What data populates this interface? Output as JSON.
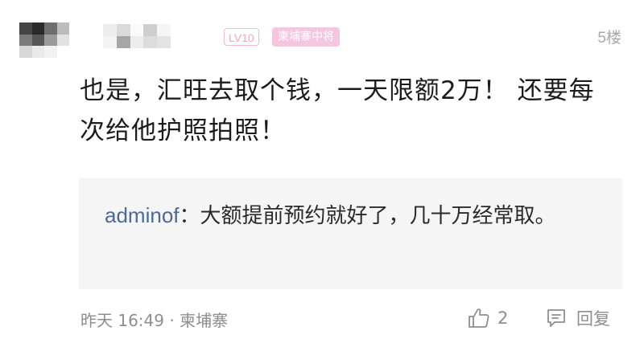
{
  "comment": {
    "level_badge": "LV10",
    "title_badge": "柬埔寨中将",
    "floor": "5楼",
    "content": "也是，汇旺去取个钱，一天限额2万！ 还要每次给他护照拍照！",
    "quote": {
      "author": "adminof",
      "separator": "：",
      "text": "大额提前预约就好了，几十万经常取。"
    },
    "meta": {
      "time": "昨天 16:49",
      "dot": " · ",
      "location": "柬埔寨"
    },
    "like_count": "2",
    "reply_label": "回复"
  },
  "icons": {
    "avatar": "avatar-blurred",
    "like": "thumbs-up-icon",
    "reply": "comment-icon"
  },
  "colors": {
    "level_badge": "#f3a7c2",
    "title_badge_bg": "#f5c6df",
    "quote_author": "#4d6a93",
    "meta_text": "#8e8e8e",
    "quote_bg": "#f5f5f5"
  }
}
